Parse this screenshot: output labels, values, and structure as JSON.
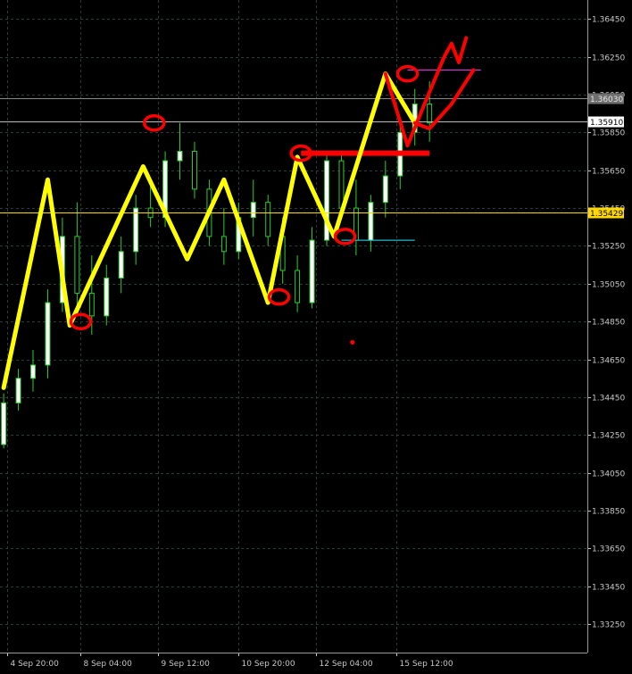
{
  "colors": {
    "background": "#000000",
    "grid": "#2f3a3a",
    "axis_text": "#c8c8c8",
    "candle_up": "#ffffff",
    "candle_down": "#000000",
    "candle_wick": "#2ecc2e",
    "yellow_line": "#ffff00",
    "red_marker": "#ff0000",
    "tag_gray": "#6e6e6e",
    "tag_yellow": "#ffd800",
    "line_purple": "#cc33cc",
    "line_cyan": "#22bbcc"
  },
  "chart_data": {
    "type": "candlestick",
    "title": "",
    "xlabel": "",
    "ylabel": "",
    "ylim": [
      1.331,
      1.3655
    ],
    "yticks": [
      "1.36450",
      "1.36250",
      "1.36050",
      "1.35850",
      "1.35650",
      "1.35450",
      "1.35250",
      "1.35050",
      "1.34850",
      "1.34650",
      "1.34450",
      "1.34250",
      "1.34050",
      "1.33850",
      "1.33650",
      "1.33450",
      "1.33250"
    ],
    "xticks": [
      "4 Sep 20:00",
      "8 Sep 04:00",
      "9 Sep 12:00",
      "10 Sep 20:00",
      "12 Sep 04:00",
      "15 Sep 12:00"
    ],
    "price_tags": [
      {
        "label": "1.36030",
        "value": 1.3603,
        "style": "gray"
      },
      {
        "label": "1.35910",
        "value": 1.3591,
        "style": "white"
      },
      {
        "label": "1.35429",
        "value": 1.35429,
        "style": "yellow"
      }
    ],
    "candles": [
      [
        1.342,
        1.3447,
        1.3418,
        1.3442
      ],
      [
        1.3442,
        1.346,
        1.3438,
        1.3455
      ],
      [
        1.3455,
        1.347,
        1.3448,
        1.3462
      ],
      [
        1.3462,
        1.3502,
        1.3455,
        1.3495
      ],
      [
        1.3495,
        1.354,
        1.349,
        1.353
      ],
      [
        1.353,
        1.3548,
        1.349,
        1.35
      ],
      [
        1.35,
        1.352,
        1.3478,
        1.3488
      ],
      [
        1.3488,
        1.3515,
        1.3483,
        1.3508
      ],
      [
        1.3508,
        1.353,
        1.35,
        1.3522
      ],
      [
        1.3522,
        1.3552,
        1.3515,
        1.3545
      ],
      [
        1.3545,
        1.356,
        1.3535,
        1.354
      ],
      [
        1.354,
        1.3575,
        1.3535,
        1.357
      ],
      [
        1.357,
        1.359,
        1.356,
        1.3575
      ],
      [
        1.3575,
        1.358,
        1.355,
        1.3555
      ],
      [
        1.3555,
        1.356,
        1.3525,
        1.353
      ],
      [
        1.353,
        1.3545,
        1.3515,
        1.3522
      ],
      [
        1.3522,
        1.3548,
        1.3518,
        1.354
      ],
      [
        1.354,
        1.356,
        1.353,
        1.3548
      ],
      [
        1.3548,
        1.3552,
        1.3525,
        1.353
      ],
      [
        1.353,
        1.354,
        1.3505,
        1.3512
      ],
      [
        1.3512,
        1.352,
        1.349,
        1.3495
      ],
      [
        1.3495,
        1.3535,
        1.3492,
        1.3528
      ],
      [
        1.3528,
        1.3575,
        1.3525,
        1.357
      ],
      [
        1.357,
        1.3575,
        1.354,
        1.3545
      ],
      [
        1.3545,
        1.356,
        1.352,
        1.3528
      ],
      [
        1.3528,
        1.3552,
        1.3522,
        1.3548
      ],
      [
        1.3548,
        1.357,
        1.354,
        1.3562
      ],
      [
        1.3562,
        1.359,
        1.3555,
        1.3585
      ],
      [
        1.3585,
        1.3608,
        1.3578,
        1.36
      ],
      [
        1.36,
        1.3612,
        1.358,
        1.359
      ]
    ],
    "zigzag": [
      [
        0,
        1.345
      ],
      [
        6,
        1.356
      ],
      [
        9,
        1.3483
      ],
      [
        19,
        1.3567
      ],
      [
        25,
        1.3518
      ],
      [
        30,
        1.356
      ],
      [
        36,
        1.3495
      ],
      [
        40,
        1.3572
      ],
      [
        45,
        1.353
      ],
      [
        52,
        1.3616
      ],
      [
        56,
        1.359
      ]
    ],
    "zigzag_extra": [
      [
        52,
        1.3616
      ],
      [
        55,
        1.3578
      ],
      [
        57,
        1.3597
      ],
      [
        60,
        1.3625
      ],
      [
        61,
        1.3632
      ],
      [
        62,
        1.3622
      ],
      [
        63,
        1.3635
      ]
    ],
    "zigzag_extra2": [
      [
        56,
        1.359
      ],
      [
        58,
        1.3587
      ],
      [
        61,
        1.36
      ],
      [
        64,
        1.3618
      ]
    ],
    "circles": [
      [
        10.5,
        1.3485
      ],
      [
        20.5,
        1.359
      ],
      [
        37.5,
        1.3498
      ],
      [
        40.5,
        1.3574
      ],
      [
        46.5,
        1.353
      ],
      [
        55,
        1.3616
      ]
    ],
    "hlines": [
      {
        "x0": 40.5,
        "x1": 58,
        "value": 1.3574,
        "style": "red-thick"
      },
      {
        "x0": 55,
        "x1": 65,
        "value": 1.3618,
        "style": "purple"
      },
      {
        "x0": 46,
        "x1": 56,
        "value": 1.3528,
        "style": "cyan"
      }
    ],
    "dot": [
      47.5,
      1.3474
    ]
  }
}
